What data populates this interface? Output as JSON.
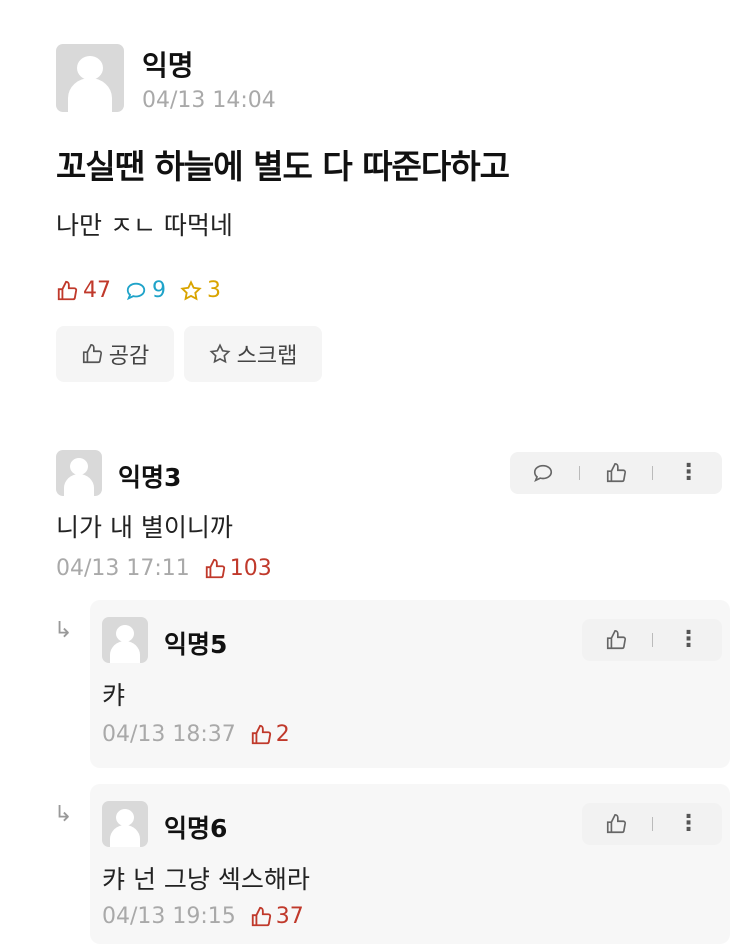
{
  "post": {
    "author": "익명",
    "time": "04/13 14:04",
    "title": "꼬실땐 하늘에 별도 다 따준다하고",
    "body": "나만 ㅈㄴ 따먹네",
    "likes": "47",
    "comments": "9",
    "scraps": "3",
    "like_button": "공감",
    "scrap_button": "스크랩"
  },
  "comments": [
    {
      "author": "익명3",
      "text": "니가 내 별이니까",
      "time": "04/13 17:11",
      "likes": "103"
    },
    {
      "author": "익명5",
      "text": "캬",
      "time": "04/13 18:37",
      "likes": "2"
    },
    {
      "author": "익명6",
      "text": "캬 넌 그냥 섹스해라",
      "time": "04/13 19:15",
      "likes": "37"
    }
  ],
  "icons": {
    "like": "thumbs-up-icon",
    "comment": "speech-bubble-icon",
    "scrap": "star-icon",
    "more": "more-vertical-icon",
    "reply": "reply-arrow-icon"
  },
  "colors": {
    "like": "#c0392b",
    "comment": "#1fa3c9",
    "scrap": "#d9a400"
  }
}
